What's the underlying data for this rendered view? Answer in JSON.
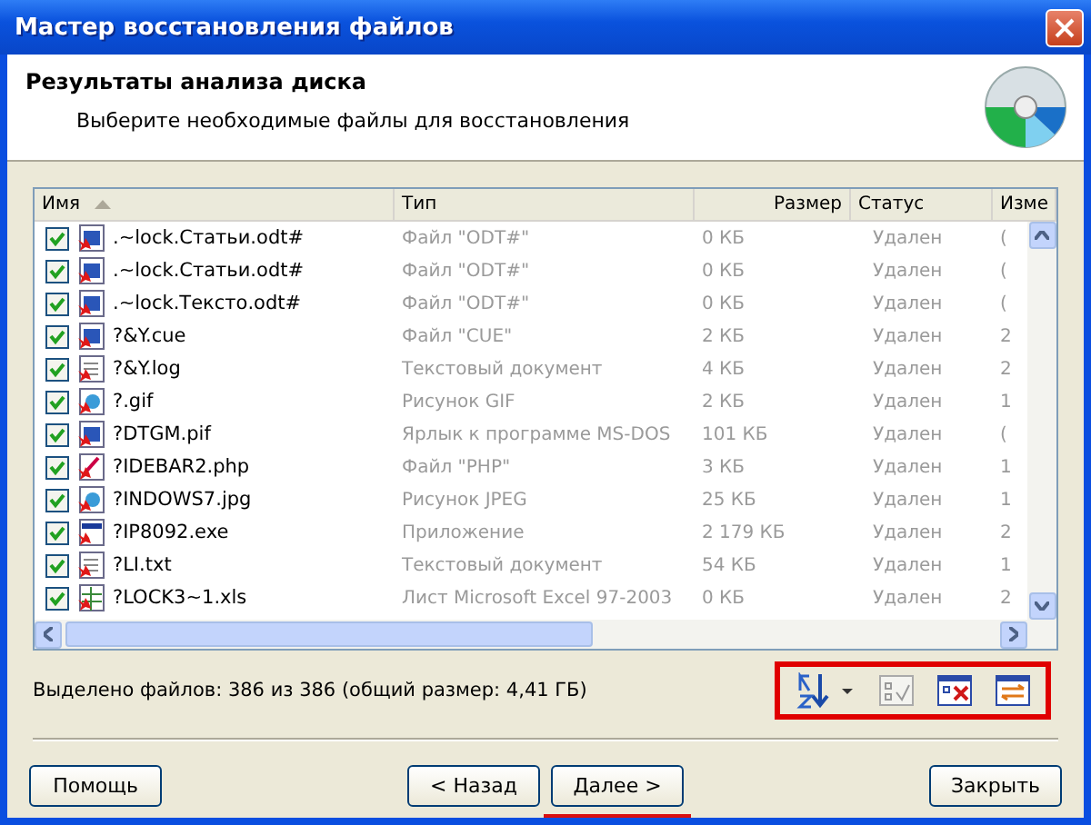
{
  "window": {
    "title": "Мастер восстановления файлов"
  },
  "header": {
    "title": "Результаты анализа диска",
    "subtitle": "Выберите необходимые файлы для восстановления"
  },
  "table": {
    "columns": [
      {
        "label": "Имя",
        "sorted": true
      },
      {
        "label": "Тип",
        "sorted": false
      },
      {
        "label": "Размер",
        "sorted": false
      },
      {
        "label": "Статус",
        "sorted": false
      },
      {
        "label": "Изме",
        "sorted": false
      }
    ],
    "rows": [
      {
        "checked": true,
        "kind": "app",
        "name": ".~lock.Статьи.odt#",
        "type": "Файл \"ODT#\"",
        "size": "0 КБ",
        "status": "Удален",
        "modified": "("
      },
      {
        "checked": true,
        "kind": "app",
        "name": ".~lock.Статьи.odt#",
        "type": "Файл \"ODT#\"",
        "size": "0 КБ",
        "status": "Удален",
        "modified": "("
      },
      {
        "checked": true,
        "kind": "app",
        "name": ".~lock.Тексто.odt#",
        "type": "Файл \"ODT#\"",
        "size": "0 КБ",
        "status": "Удален",
        "modified": "("
      },
      {
        "checked": true,
        "kind": "app",
        "name": "?&Y.cue",
        "type": "Файл \"CUE\"",
        "size": "2 КБ",
        "status": "Удален",
        "modified": "2"
      },
      {
        "checked": true,
        "kind": "text",
        "name": "?&Y.log",
        "type": "Текстовый документ",
        "size": "4 КБ",
        "status": "Удален",
        "modified": "2"
      },
      {
        "checked": true,
        "kind": "image",
        "name": "?.gif",
        "type": "Рисунок GIF",
        "size": "2 КБ",
        "status": "Удален",
        "modified": "1"
      },
      {
        "checked": true,
        "kind": "app",
        "name": "?DTGM.pif",
        "type": "Ярлык к программе MS-DOS",
        "size": "101 КБ",
        "status": "Удален",
        "modified": "("
      },
      {
        "checked": true,
        "kind": "script",
        "name": "?IDEBAR2.php",
        "type": "Файл \"PHP\"",
        "size": "3 КБ",
        "status": "Удален",
        "modified": "1"
      },
      {
        "checked": true,
        "kind": "image",
        "name": "?INDOWS7.jpg",
        "type": "Рисунок JPEG",
        "size": "25 КБ",
        "status": "Удален",
        "modified": "1"
      },
      {
        "checked": true,
        "kind": "exe",
        "name": "?IP8092.exe",
        "type": "Приложение",
        "size": "2 179 КБ",
        "status": "Удален",
        "modified": "2"
      },
      {
        "checked": true,
        "kind": "text",
        "name": "?LI.txt",
        "type": "Текстовый документ",
        "size": "54 КБ",
        "status": "Удален",
        "modified": "1"
      },
      {
        "checked": true,
        "kind": "sheet",
        "name": "?LOCK3~1.xls",
        "type": "Лист Microsoft Excel 97-2003",
        "size": "0 КБ",
        "status": "Удален",
        "modified": "2"
      }
    ]
  },
  "selection_summary": "Выделено файлов: 386 из 386 (общий размер: 4,41 ГБ)",
  "toolbar": {
    "highlighted": true
  },
  "buttons": [
    {
      "label": "Помощь",
      "kind": "help",
      "underlined": false
    },
    {
      "label": "< Назад",
      "kind": "back",
      "underlined": false
    },
    {
      "label": "Далее >",
      "kind": "next",
      "underlined": true
    },
    {
      "label": "Закрыть",
      "kind": "close",
      "underlined": false
    }
  ]
}
